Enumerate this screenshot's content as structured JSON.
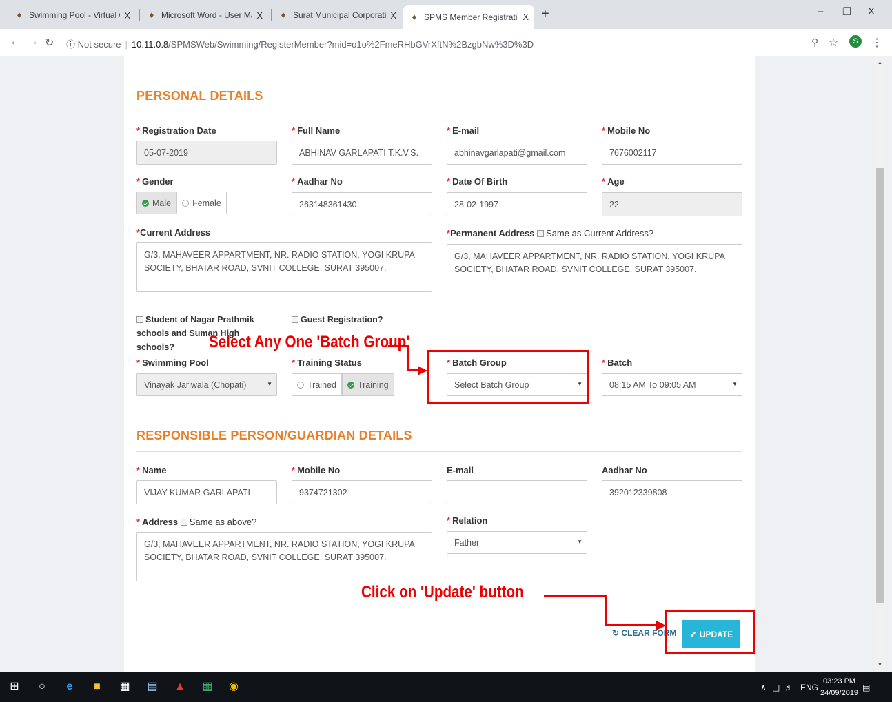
{
  "browser": {
    "tabs": [
      {
        "title": "Swimming Pool - Virtual Civic Ce",
        "active": false
      },
      {
        "title": "Microsoft Word - User Manual fo",
        "active": false
      },
      {
        "title": "Surat Municipal Corporation - Ap",
        "active": false
      },
      {
        "title": "SPMS Member Registration :: Sur",
        "active": true
      }
    ],
    "close_glyph": "X",
    "new_tab": "+",
    "security": "Not secure",
    "url_host": "10.11.0.8",
    "url_path": "/SPMSWeb/Swimming/RegisterMember?mid=o1o%2FmeRHbGVrXftN%2BzgbNw%3D%3D",
    "profile_initial": "S"
  },
  "personal": {
    "title": "PERSONAL DETAILS",
    "registration_date": {
      "label": "Registration Date",
      "value": "05-07-2019"
    },
    "full_name": {
      "label": "Full Name",
      "value": "ABHINAV GARLAPATI T.K.V.S."
    },
    "email": {
      "label": "E-mail",
      "value": "abhinavgarlapati@gmail.com"
    },
    "mobile": {
      "label": "Mobile No",
      "value": "7676002117"
    },
    "gender": {
      "label": "Gender",
      "male": "Male",
      "female": "Female",
      "selected": "Male"
    },
    "aadhar": {
      "label": "Aadhar No",
      "value": "263148361430"
    },
    "dob": {
      "label": "Date Of Birth",
      "value": "28-02-1997"
    },
    "age": {
      "label": "Age",
      "value": "22"
    },
    "current_address": {
      "label": "Current Address",
      "value": "G/3, MAHAVEER APPARTMENT, NR. RADIO STATION, YOGI KRUPA SOCIETY, BHATAR ROAD, SVNIT COLLEGE, SURAT 395007."
    },
    "permanent_address": {
      "label": "Permanent Address",
      "same_label": "Same as Current Address?",
      "value": "G/3, MAHAVEER APPARTMENT, NR. RADIO STATION, YOGI KRUPA SOCIETY, BHATAR ROAD, SVNIT COLLEGE, SURAT 395007."
    },
    "student_check": "Student of Nagar Prathmik schools and Suman High schools?",
    "guest_check": "Guest Registration?",
    "swimming_pool": {
      "label": "Swimming Pool",
      "value": "Vinayak Jariwala (Chopati)"
    },
    "training_status": {
      "label": "Training Status",
      "trained": "Trained",
      "training": "Training",
      "selected": "Training"
    },
    "batch_group": {
      "label": "Batch Group",
      "value": "Select Batch Group"
    },
    "batch": {
      "label": "Batch",
      "value": "08:15 AM To 09:05 AM"
    }
  },
  "guardian": {
    "title": "RESPONSIBLE PERSON/GUARDIAN DETAILS",
    "name": {
      "label": "Name",
      "value": "VIJAY KUMAR GARLAPATI"
    },
    "mobile": {
      "label": "Mobile No",
      "value": "9374721302"
    },
    "email": {
      "label": "E-mail",
      "value": ""
    },
    "aadhar": {
      "label": "Aadhar No",
      "value": "392012339808"
    },
    "address": {
      "label": "Address",
      "same_label": "Same as above?",
      "value": "G/3, MAHAVEER APPARTMENT, NR. RADIO STATION, YOGI KRUPA SOCIETY, BHATAR ROAD, SVNIT COLLEGE, SURAT 395007."
    },
    "relation": {
      "label": "Relation",
      "value": "Father"
    }
  },
  "actions": {
    "clear": "CLEAR FORM",
    "update": "UPDATE"
  },
  "annotations": {
    "batch_group": "Select Any One 'Batch Group'",
    "update": "Click on 'Update' button"
  },
  "taskbar": {
    "lang": "ENG",
    "time": "03:23 PM",
    "date": "24/09/2019"
  },
  "colors": {
    "section_title": "#e8812c",
    "annotation": "#ee0000",
    "update_button": "#27b6d7"
  }
}
